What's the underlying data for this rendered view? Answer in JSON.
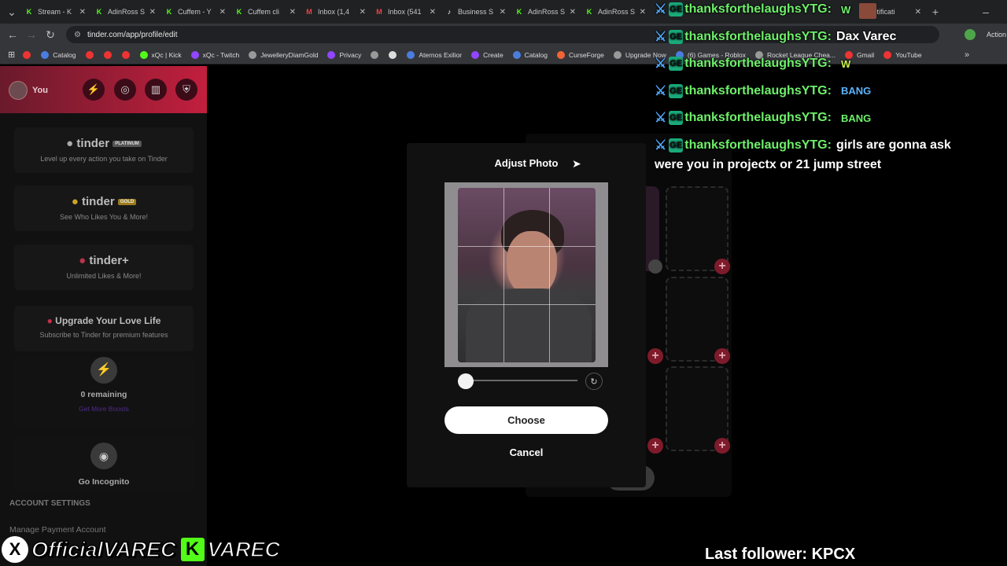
{
  "browser": {
    "tabs": [
      {
        "label": "Stream - K",
        "icon": "kick-icon"
      },
      {
        "label": "AdinRoss S",
        "icon": "kick-icon"
      },
      {
        "label": "Cuffem - Y",
        "icon": "kick-icon"
      },
      {
        "label": "Cuffem cli",
        "icon": "kick-icon"
      },
      {
        "label": "Inbox (1,4",
        "icon": "gmail-icon"
      },
      {
        "label": "Inbox (541",
        "icon": "gmail-icon"
      },
      {
        "label": "Business S",
        "icon": "tiktok-icon"
      },
      {
        "label": "AdinRoss S",
        "icon": "kick-icon"
      },
      {
        "label": "AdinRoss S",
        "icon": "kick-icon"
      }
    ],
    "notification_tab": "Notificati",
    "url": "tinder.com/app/profile/edit",
    "actions_label": "Action",
    "bookmarks": [
      {
        "label": "",
        "color": "#e33"
      },
      {
        "label": "Catalog",
        "color": "#4a7dde"
      },
      {
        "label": "",
        "color": "#e33"
      },
      {
        "label": "",
        "color": "#e33"
      },
      {
        "label": "",
        "color": "#e33"
      },
      {
        "label": "xQc | Kick",
        "color": "#53fc18"
      },
      {
        "label": "xQc - Twitch",
        "color": "#9146ff"
      },
      {
        "label": "JewelleryDiamGold",
        "color": "#999"
      },
      {
        "label": "Privacy",
        "color": "#9146ff"
      },
      {
        "label": "",
        "color": "#999"
      },
      {
        "label": "",
        "color": "#ddd"
      },
      {
        "label": "Aternos Exilior",
        "color": "#4a7dde"
      },
      {
        "label": "Create",
        "color": "#9146ff"
      },
      {
        "label": "Catalog",
        "color": "#4a7dde"
      },
      {
        "label": "CurseForge",
        "color": "#f16436"
      },
      {
        "label": "Upgrade Now",
        "color": "#999"
      },
      {
        "label": "(6) Games - Roblox",
        "color": "#4a7dde"
      },
      {
        "label": "Rocket League Chea...",
        "color": "#999"
      },
      {
        "label": "Gmail",
        "color": "#e33"
      },
      {
        "label": "YouTube",
        "color": "#e33"
      }
    ]
  },
  "tinder": {
    "profile_label": "You",
    "cards": [
      {
        "title": "tinder",
        "badge": "PLATINUM",
        "subtitle": "Level up every action you take on Tinder"
      },
      {
        "title": "tinder",
        "badge": "GOLD",
        "subtitle": "See Who Likes You & More!"
      },
      {
        "title": "tinder+",
        "badge": "",
        "subtitle": "Unlimited Likes & More!"
      },
      {
        "title": "Upgrade Your Love Life",
        "badge": "",
        "subtitle": "Subscribe to Tinder for premium features"
      }
    ],
    "boosts_remaining": "0 remaining",
    "get_more_boosts": "Get More Boosts",
    "go_incognito": "Go Incognito",
    "account_settings": "ACCOUNT SETTINGS",
    "manage_payment": "Manage Payment Account"
  },
  "modal": {
    "title": "Adjust Photo",
    "choose_label": "Choose",
    "cancel_label": "Cancel",
    "zoom_level": 0
  },
  "chat": [
    {
      "user": "thanksforthelaughsYTG:",
      "msg": "",
      "emote": "W",
      "emote_color": "#6ef06a"
    },
    {
      "user": "thanksforthelaughsYTG:",
      "msg": "Dax Varec",
      "emote": "",
      "emote_color": ""
    },
    {
      "user": "thanksforthelaughsYTG:",
      "msg": "",
      "emote": "W",
      "emote_color": "#c9f04a"
    },
    {
      "user": "thanksforthelaughsYTG:",
      "msg": "",
      "emote": "BANG",
      "emote_color": "#5ab4ff"
    },
    {
      "user": "thanksforthelaughsYTG:",
      "msg": "",
      "emote": "BANG",
      "emote_color": "#6ef06a"
    },
    {
      "user": "thanksforthelaughsYTG:",
      "msg": "girls are gonna ask",
      "emote": "",
      "emote_color": ""
    }
  ],
  "chat_continuation": "were you in projectx or 21 jump street",
  "overlay": {
    "handle": "OfficialVAREC",
    "kick_name": "VAREC",
    "last_follower": "Last follower: KPCX"
  }
}
